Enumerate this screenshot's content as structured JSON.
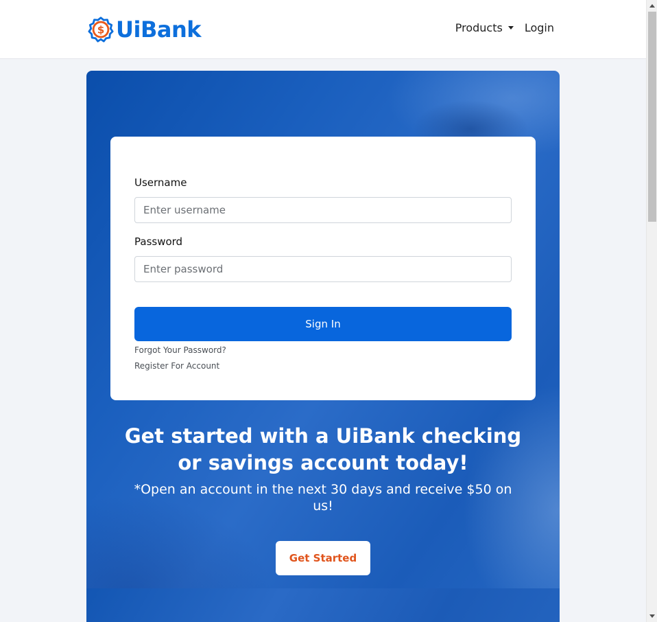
{
  "header": {
    "brand": "UiBank",
    "nav": {
      "products_label": "Products",
      "login_label": "Login"
    }
  },
  "login_form": {
    "username_label": "Username",
    "username_placeholder": "Enter username",
    "password_label": "Password",
    "password_placeholder": "Enter password",
    "signin_label": "Sign In",
    "forgot_label": "Forgot Your Password?",
    "register_label": "Register For Account"
  },
  "promo": {
    "headline_line1": "Get started with a UiBank checking",
    "headline_line2": "or savings account today!",
    "subline_line1": "*Open an account in the next 30 days and receive $50 on",
    "subline_line2": "us!",
    "cta_label": "Get Started"
  },
  "colors": {
    "brand_blue": "#0d6fdc",
    "brand_orange": "#e8591a",
    "primary_button": "#0866dd",
    "cta_text": "#e0541c"
  },
  "icons": {
    "logo": "dollar-badge-icon",
    "products_caret": "caret-down-icon"
  }
}
